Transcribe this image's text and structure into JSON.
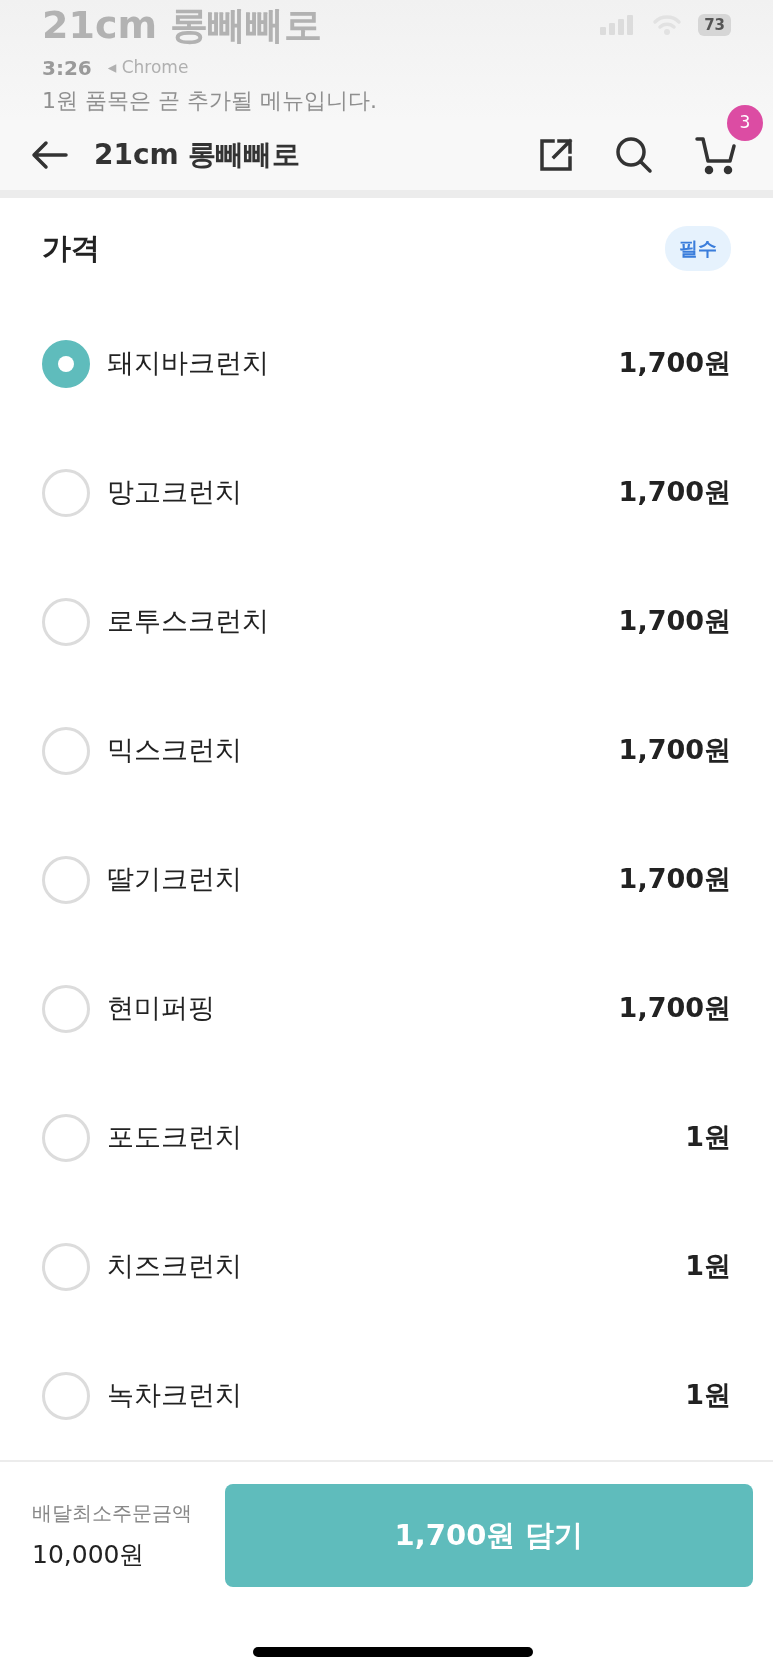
{
  "behind_page": {
    "title": "21cm 롱빼빼로",
    "notice": "1원 품목은 곧 추가될 메뉴입니다."
  },
  "status_bar": {
    "time": "3:26",
    "back_app": "◂ Chrome",
    "battery": "73"
  },
  "header": {
    "title": "21cm 롱빼빼로",
    "cart_count": "3"
  },
  "option_group": {
    "title": "가격",
    "badge": "필수",
    "options": [
      {
        "name": "돼지바크런치",
        "price": "1,700원",
        "selected": true
      },
      {
        "name": "망고크런치",
        "price": "1,700원",
        "selected": false
      },
      {
        "name": "로투스크런치",
        "price": "1,700원",
        "selected": false
      },
      {
        "name": "믹스크런치",
        "price": "1,700원",
        "selected": false
      },
      {
        "name": "딸기크런치",
        "price": "1,700원",
        "selected": false
      },
      {
        "name": "현미퍼핑",
        "price": "1,700원",
        "selected": false
      },
      {
        "name": "포도크런치",
        "price": "1원",
        "selected": false
      },
      {
        "name": "치즈크런치",
        "price": "1원",
        "selected": false
      },
      {
        "name": "녹차크런치",
        "price": "1원",
        "selected": false
      }
    ]
  },
  "footer": {
    "min_order_label": "배달최소주문금액",
    "min_order_value": "10,000원",
    "add_button": "1,700원 담기"
  }
}
